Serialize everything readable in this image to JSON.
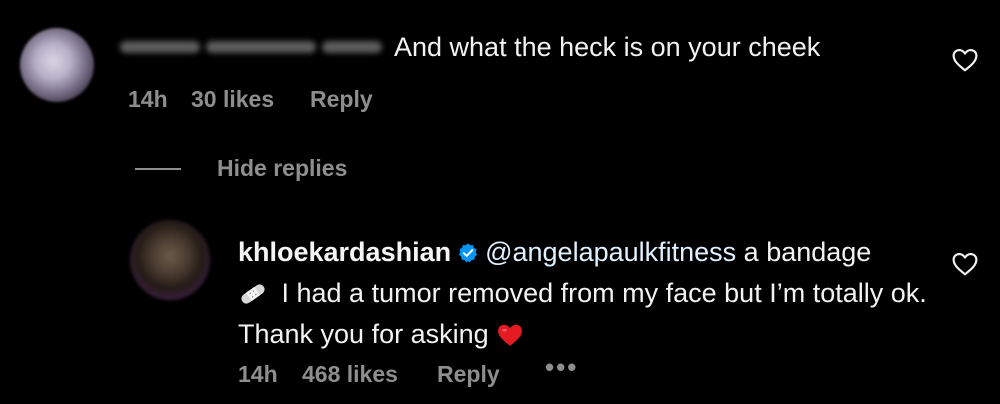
{
  "comment1": {
    "username": "angelapaulkfitness",
    "text": "And what the heck is on your cheek",
    "time": "14h",
    "likes": "30 likes",
    "reply_label": "Reply",
    "heart_icon": "heart-outline-icon"
  },
  "thread": {
    "hide_replies_label": "Hide replies"
  },
  "comment2": {
    "username": "khloekardashian",
    "verified_icon": "verified-badge-icon",
    "mention": "@angelapaulkfitness",
    "text_part1": " a bandage",
    "bandage_icon": "bandage-emoji-icon",
    "text_part2": " I had a tumor removed from my face but I’m totally ok. Thank you for asking",
    "red_heart_icon": "red-heart-emoji-icon",
    "time": "14h",
    "likes": "468 likes",
    "reply_label": "Reply",
    "more_label": "•••",
    "heart_icon": "heart-outline-icon"
  },
  "colors": {
    "background": "#000000",
    "text": "#f2f2f2",
    "meta": "#8e8e8e",
    "verified": "#0095f6",
    "red_heart": "#e41b23"
  }
}
